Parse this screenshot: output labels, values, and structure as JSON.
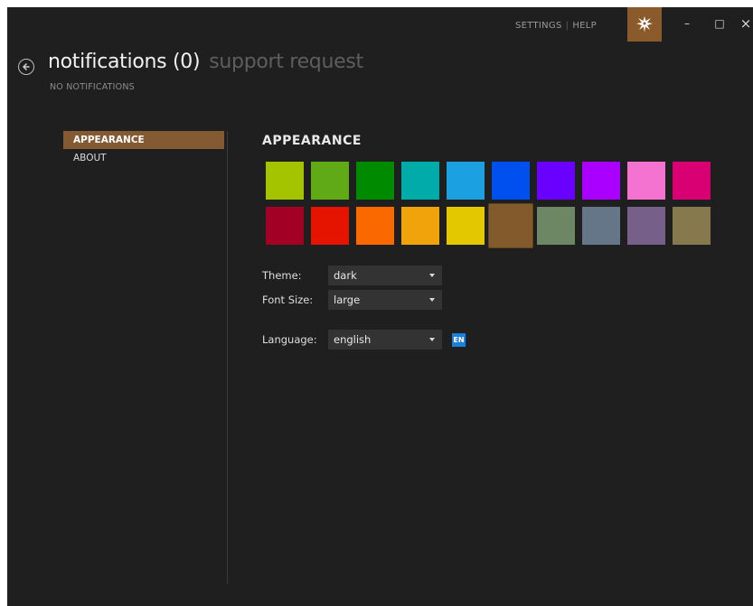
{
  "header": {
    "links": {
      "settings": "SETTINGS",
      "separator": "|",
      "help": "HELP"
    },
    "logo_icon": "bird-logo-icon",
    "window_controls": {
      "minimize": "–",
      "maximize": "□",
      "close": "×"
    }
  },
  "page": {
    "title": "notifications (0)",
    "secondary_title": "support request",
    "subtitle": "NO NOTIFICATIONS"
  },
  "sidebar": {
    "items": [
      {
        "label": "APPEARANCE",
        "active": true
      },
      {
        "label": "ABOUT",
        "active": false
      }
    ]
  },
  "appearance": {
    "section_title": "APPEARANCE",
    "colors_row1": [
      "#a4c400",
      "#60a917",
      "#008a00",
      "#00aba9",
      "#1ba1e2",
      "#0050ef",
      "#6a00ff",
      "#aa00ff",
      "#f472d0",
      "#d80073"
    ],
    "colors_row2": [
      "#a20025",
      "#e51400",
      "#fa6800",
      "#f0a30a",
      "#e3c800",
      "#825a2c",
      "#6d8764",
      "#647687",
      "#76608a",
      "#87794e"
    ],
    "selected_color": "#825a2c",
    "theme": {
      "label": "Theme:",
      "value": "dark"
    },
    "font_size": {
      "label": "Font Size:",
      "value": "large"
    },
    "language": {
      "label": "Language:",
      "value": "english",
      "badge": "EN"
    }
  }
}
